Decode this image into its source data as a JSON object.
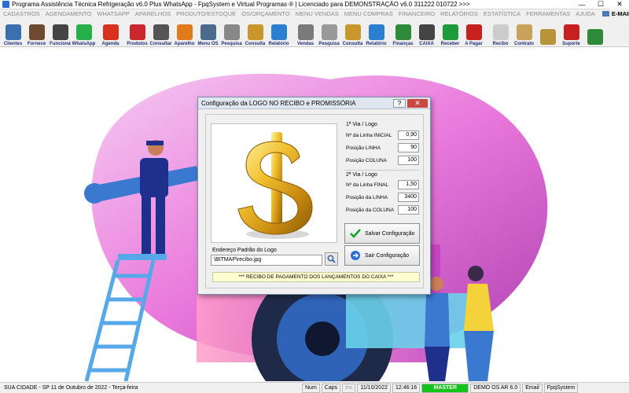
{
  "window": {
    "title": "Programa Assistência Técnica Refrigeração v6.0 Plus WhatsApp - FpqSystem e Virtual Programas ® | Licenciado para  DEMONSTRAÇÃO v6.0 311222 010722 >>>",
    "minimize": "—",
    "maximize": "☐",
    "close": "✕"
  },
  "menu": {
    "items": [
      "CADASTROS",
      "AGENDAMENTO",
      "WHATSAPP",
      "APARELHOS",
      "PRODUTO/ESTOQUE",
      "OS/ORÇAMENTO",
      "MENU VENDAS",
      "MENU COMPRAS",
      "FINANCEIRO",
      "RELATÓRIOS",
      "ESTATÍSTICA",
      "FERRAMENTAS",
      "AJUDA"
    ],
    "email": "E-MAIL"
  },
  "toolbar": {
    "buttons": [
      {
        "label": "Clientes",
        "color": "#3a6fb0"
      },
      {
        "label": "Fornece",
        "color": "#6f4a2f"
      },
      {
        "label": "Funcioná",
        "color": "#444"
      },
      {
        "label": "WhatsApp",
        "color": "#26b04a"
      },
      {
        "label": "Agenda",
        "color": "#d8321f"
      },
      {
        "label": "Produtos",
        "color": "#c8282e"
      },
      {
        "label": "Consultar",
        "color": "#555"
      },
      {
        "label": "Aparelho",
        "color": "#e07a1a"
      },
      {
        "label": "Menu OS",
        "color": "#4b6a8c"
      },
      {
        "label": "Pesquisa",
        "color": "#888"
      },
      {
        "label": "Consulta",
        "color": "#c9962c"
      },
      {
        "label": "Relatório",
        "color": "#2a7fd0"
      },
      {
        "label": "Vendas",
        "color": "#7a7a7a"
      },
      {
        "label": "Pesquisa",
        "color": "#999"
      },
      {
        "label": "Consulta",
        "color": "#c9962c"
      },
      {
        "label": "Relatório",
        "color": "#2a7fd0"
      },
      {
        "label": "Finanças",
        "color": "#2e8b3a"
      },
      {
        "label": "CAIXA",
        "color": "#444"
      },
      {
        "label": "Receber",
        "color": "#1b9b3a"
      },
      {
        "label": "A Pagar",
        "color": "#c8201f"
      },
      {
        "label": "Recibo",
        "color": "#ccc"
      },
      {
        "label": "Contrato",
        "color": "#c9a25a"
      },
      {
        "label": "",
        "color": "#b8933a"
      },
      {
        "label": "Suporte",
        "color": "#c8201f"
      },
      {
        "label": "",
        "color": "#2e8b3a"
      }
    ]
  },
  "dialog": {
    "title": "Configuração da LOGO NO RECIBO e PROMISSÓRIA",
    "help": "?",
    "close": "✕",
    "via1": {
      "title": "1ª Via / Logo",
      "fields": [
        {
          "label": "Nº da Linha INICIAL",
          "value": "0,90"
        },
        {
          "label": "Posição LINHA",
          "value": "90"
        },
        {
          "label": "Posição COLUNA",
          "value": "100"
        }
      ]
    },
    "via2": {
      "title": "2ª Via / Logo",
      "fields": [
        {
          "label": "Nº da Linha FINAL",
          "value": "1,50"
        },
        {
          "label": "Posição da LINHA",
          "value": "3400"
        },
        {
          "label": "Posição da COLUNA",
          "value": "100"
        }
      ]
    },
    "address_label": "Endereço Padrão do Logo",
    "address_value": "\\BITMAP\\recibo.jpg",
    "save_button": "Salvar Configuração",
    "exit_button": "Sair Configuração",
    "footer": "*** RECIBO DE PAGAMENTO DOS LANÇAMENTOS DO CAIXA ***"
  },
  "status": {
    "city": "SUA CIDADE - SP 11 de Outubro de 2022 - Terça-feira",
    "num": "Num",
    "caps": "Caps",
    "ins": "Ins",
    "date": "11/10/2022",
    "time": "12:46:16",
    "master": "MASTER",
    "demo": "DEMO OS AR 6.0",
    "email": "Email",
    "brand": "FpqSystem"
  }
}
